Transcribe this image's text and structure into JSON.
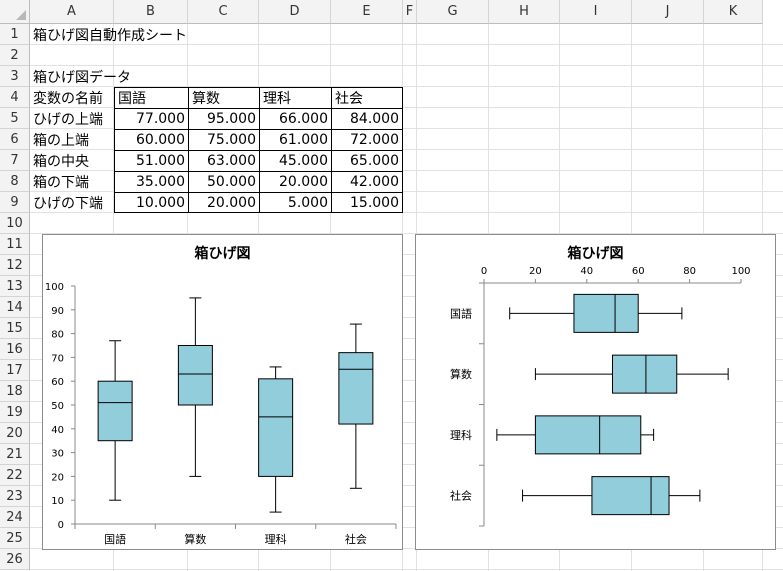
{
  "columns": [
    "A",
    "B",
    "C",
    "D",
    "E",
    "F",
    "G",
    "H",
    "I",
    "J",
    "K"
  ],
  "rows": [
    "1",
    "2",
    "3",
    "4",
    "5",
    "6",
    "7",
    "8",
    "9",
    "10",
    "11",
    "12",
    "13",
    "14",
    "15",
    "16",
    "17",
    "18",
    "19",
    "20",
    "21",
    "22",
    "23",
    "24",
    "25",
    "26"
  ],
  "sheet_title": "箱ひげ図自動作成シート",
  "data_title": "箱ひげ図データ",
  "table": {
    "header": [
      "変数の名前",
      "国語",
      "算数",
      "理科",
      "社会"
    ],
    "rows": [
      [
        "ひげの上端",
        "77.000",
        "95.000",
        "66.000",
        "84.000"
      ],
      [
        "箱の上端",
        "60.000",
        "75.000",
        "61.000",
        "72.000"
      ],
      [
        "箱の中央",
        "51.000",
        "63.000",
        "45.000",
        "65.000"
      ],
      [
        "箱の下端",
        "35.000",
        "50.000",
        "20.000",
        "42.000"
      ],
      [
        "ひげの下端",
        "10.000",
        "20.000",
        "5.000",
        "15.000"
      ]
    ]
  },
  "colors": {
    "box_fill": "#92cddc",
    "grid": "#e1e1e1",
    "header_bg": "#f3f3f3"
  },
  "chart_data": [
    {
      "type": "box-vertical",
      "title": "箱ひげ図",
      "categories": [
        "国語",
        "算数",
        "理科",
        "社会"
      ],
      "whisker_top": [
        77,
        95,
        66,
        84
      ],
      "box_top": [
        60,
        75,
        61,
        72
      ],
      "median": [
        51,
        63,
        45,
        65
      ],
      "box_bottom": [
        35,
        50,
        20,
        42
      ],
      "whisker_bottom": [
        10,
        20,
        5,
        15
      ],
      "ylim": [
        0,
        100
      ],
      "yticks": [
        "0",
        "10",
        "20",
        "30",
        "40",
        "50",
        "60",
        "70",
        "80",
        "90",
        "100"
      ]
    },
    {
      "type": "box-horizontal",
      "title": "箱ひげ図",
      "categories": [
        "国語",
        "算数",
        "理科",
        "社会"
      ],
      "whisker_top": [
        77,
        95,
        66,
        84
      ],
      "box_top": [
        60,
        75,
        61,
        72
      ],
      "median": [
        51,
        63,
        45,
        65
      ],
      "box_bottom": [
        35,
        50,
        20,
        42
      ],
      "whisker_bottom": [
        10,
        20,
        5,
        15
      ],
      "xlim": [
        0,
        100
      ],
      "xticks": [
        "0",
        "20",
        "40",
        "60",
        "80",
        "100"
      ],
      "xaxis_position": "top"
    }
  ]
}
